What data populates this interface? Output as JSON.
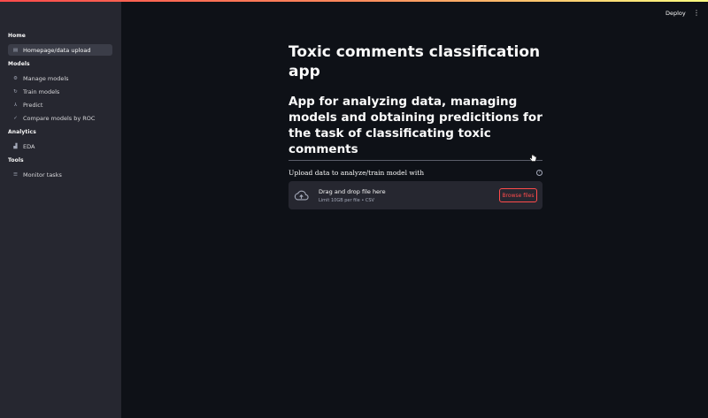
{
  "sidebar": {
    "sections": [
      {
        "label": "Home"
      },
      {
        "label": "Models"
      },
      {
        "label": "Analytics"
      },
      {
        "label": "Tools"
      }
    ],
    "items": [
      {
        "label": "Homepage/data upload",
        "icon": "document-icon"
      },
      {
        "label": "Manage models",
        "icon": "gear-icon"
      },
      {
        "label": "Train models",
        "icon": "refresh-icon"
      },
      {
        "label": "Predict",
        "icon": "network-icon"
      },
      {
        "label": "Compare models by ROC",
        "icon": "check-icon"
      },
      {
        "label": "EDA",
        "icon": "chart-icon"
      },
      {
        "label": "Monitor tasks",
        "icon": "list-icon"
      }
    ]
  },
  "header": {
    "deploy_label": "Deploy",
    "menu_icon": "kebab-menu-icon"
  },
  "main": {
    "title": "Toxic comments classification app",
    "subtitle": "App for analyzing data, managing models and obtaining predicitions for the task of classificating toxic comments",
    "upload": {
      "label": "Upload data to analyze/train model with",
      "drop_text": "Drag and drop file here",
      "limit_text": "Limit 10GB per file • CSV",
      "browse_label": "Browse files"
    }
  },
  "colors": {
    "accent": "#ff4b4b",
    "background": "#0e1117",
    "sidebar": "#262730"
  }
}
